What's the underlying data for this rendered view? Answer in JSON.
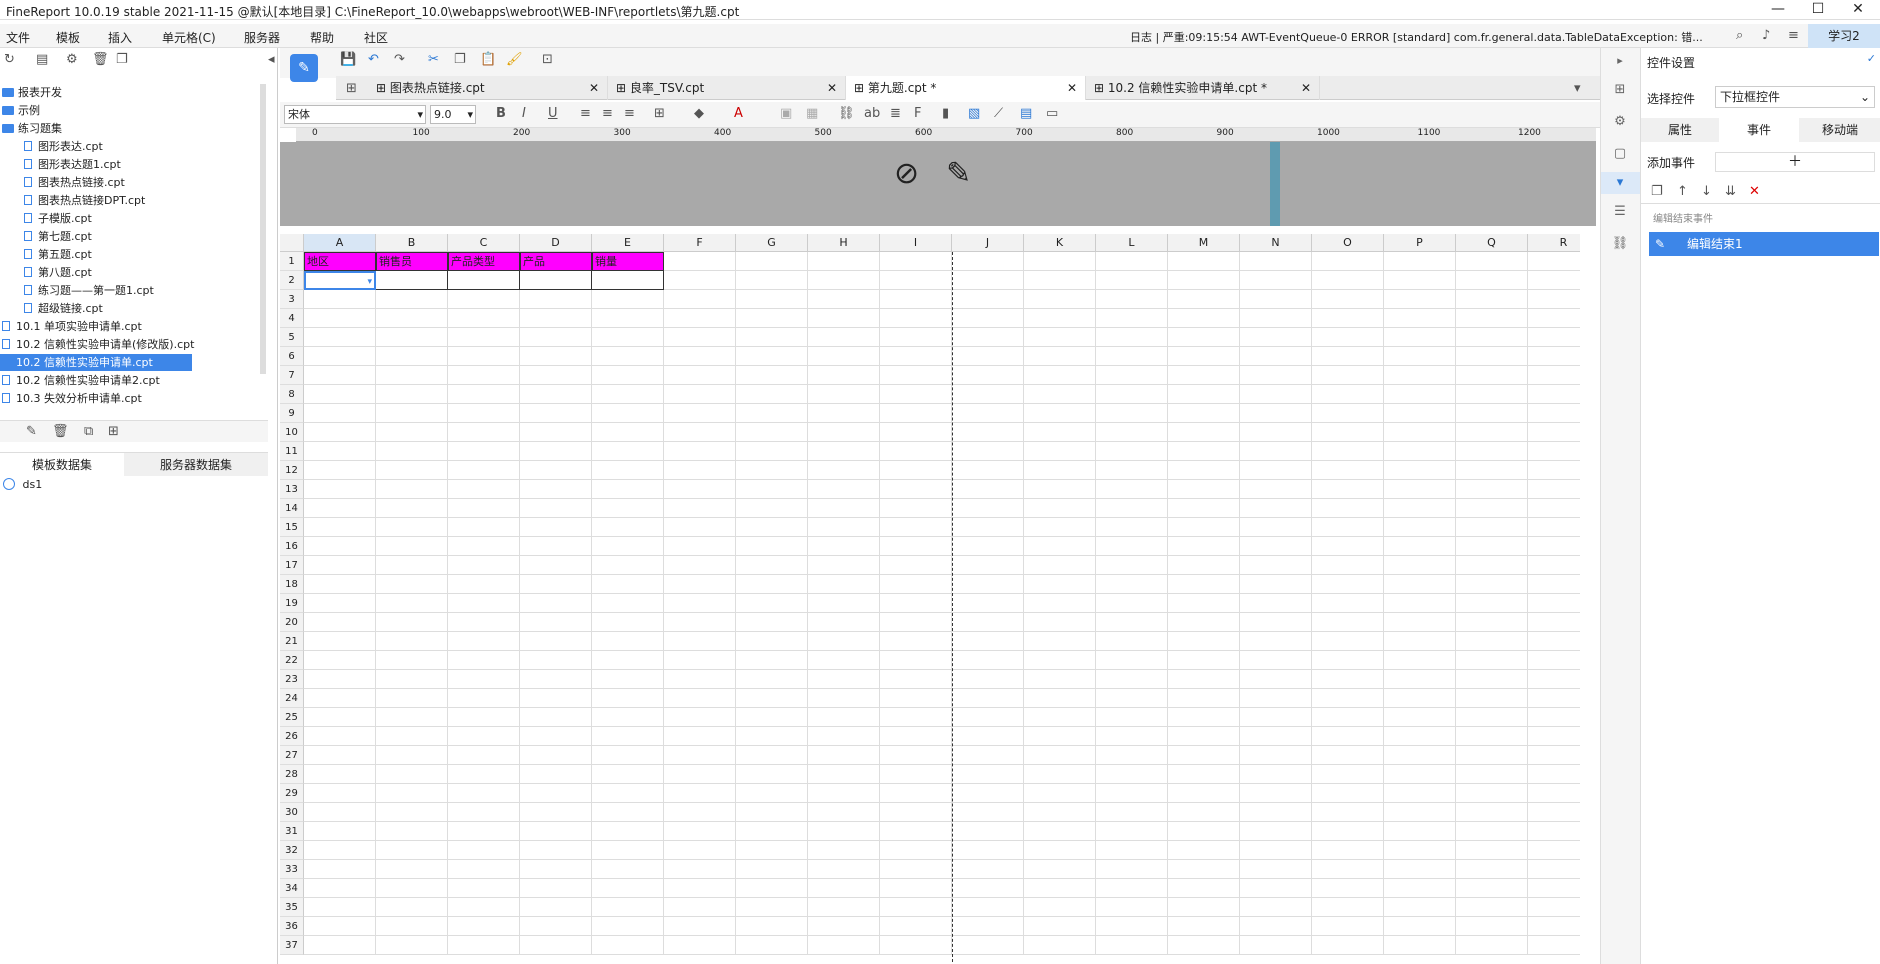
{
  "titlebar": {
    "text": "FineReport 10.0.19 stable 2021-11-15 @默认[本地目录]   C:\\FineReport_10.0\\webapps\\webroot\\WEB-INF\\reportlets\\第九题.cpt"
  },
  "menu": {
    "items": [
      "文件",
      "模板",
      "插入",
      "单元格(C)",
      "服务器",
      "帮助",
      "社区"
    ],
    "log": "日志 | 严重:09:15:54 AWT-EventQueue-0 ERROR [standard] com.fr.general.data.TableDataException: 错...",
    "user": "学习2"
  },
  "tree": {
    "items": [
      {
        "label": "报表开发",
        "type": "folder"
      },
      {
        "label": "示例",
        "type": "folder"
      },
      {
        "label": "练习题集",
        "type": "folder"
      },
      {
        "label": "图形表达.cpt",
        "type": "file"
      },
      {
        "label": "图形表达题1.cpt",
        "type": "file"
      },
      {
        "label": "图表热点链接.cpt",
        "type": "file"
      },
      {
        "label": "图表热点链接DPT.cpt",
        "type": "file"
      },
      {
        "label": "子模版.cpt",
        "type": "file"
      },
      {
        "label": "第七题.cpt",
        "type": "file"
      },
      {
        "label": "第五题.cpt",
        "type": "file"
      },
      {
        "label": "第八题.cpt",
        "type": "file"
      },
      {
        "label": "练习题——第一题1.cpt",
        "type": "file"
      },
      {
        "label": "超级链接.cpt",
        "type": "file"
      },
      {
        "label": "10.1 单项实验申请单.cpt",
        "type": "root"
      },
      {
        "label": "10.2 信赖性实验申请单(修改版).cpt",
        "type": "root"
      },
      {
        "label": "10.2 信赖性实验申请单.cpt",
        "type": "root",
        "selected": true
      },
      {
        "label": "10.2 信赖性实验申请单2.cpt",
        "type": "root"
      },
      {
        "label": "10.3 失效分析申请单.cpt",
        "type": "root"
      }
    ]
  },
  "datasets": {
    "tabs": [
      "模板数据集",
      "服务器数据集"
    ],
    "items": [
      "ds1"
    ]
  },
  "file_tabs": [
    {
      "label": "图表热点链接.cpt",
      "active": false
    },
    {
      "label": "良率_TSV.cpt",
      "active": false
    },
    {
      "label": "第九题.cpt *",
      "active": true
    },
    {
      "label": "10.2 信赖性实验申请单.cpt *",
      "active": false
    }
  ],
  "format": {
    "font": "宋体",
    "size": "9.0"
  },
  "ruler": [
    "0",
    "100",
    "200",
    "300",
    "400",
    "500",
    "600",
    "700",
    "800",
    "900",
    "1000",
    "1100",
    "1200"
  ],
  "grid": {
    "columns": [
      "A",
      "B",
      "C",
      "D",
      "E",
      "F",
      "G",
      "H",
      "I",
      "J",
      "K",
      "L",
      "M",
      "N",
      "O",
      "P",
      "Q",
      "R"
    ],
    "rows": 37,
    "header_cells": [
      "地区",
      "销售员",
      "产品类型",
      "产品",
      "销量"
    ]
  },
  "right": {
    "title": "控件设置",
    "select_label": "选择控件",
    "select_value": "下拉框控件",
    "tabs": [
      "属性",
      "事件",
      "移动端"
    ],
    "add_event": "添加事件",
    "section": "编辑结束事件",
    "event_item": "编辑结束1"
  }
}
